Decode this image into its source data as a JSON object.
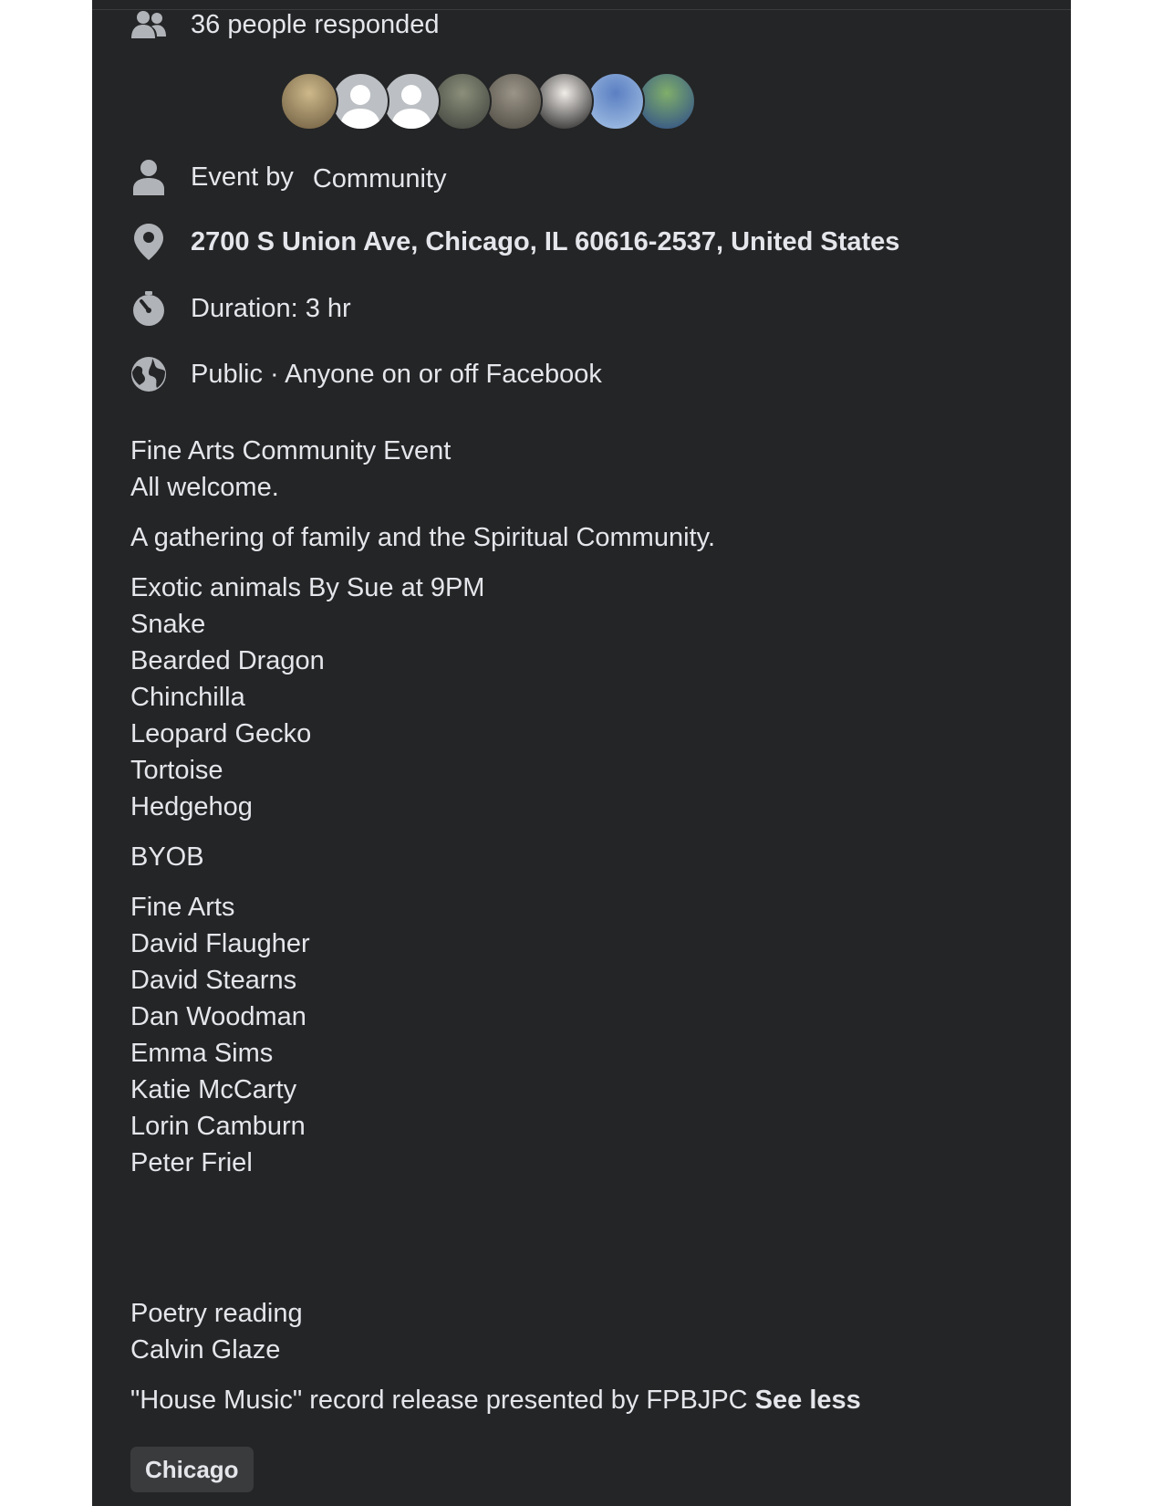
{
  "responded": {
    "text": "36 people responded",
    "icon": "people-icon"
  },
  "avatars": [
    {
      "name": "avatar-1",
      "colors": [
        "#cdb88a",
        "#6b5a3e"
      ]
    },
    {
      "name": "avatar-2-default",
      "colors": [
        "#bcc0c4",
        "#ffffff"
      ]
    },
    {
      "name": "avatar-3-default",
      "colors": [
        "#bcc0c4",
        "#ffffff"
      ]
    },
    {
      "name": "avatar-4",
      "colors": [
        "#8b8f7a",
        "#3b3f3a"
      ]
    },
    {
      "name": "avatar-5",
      "colors": [
        "#9a9488",
        "#4a463e"
      ]
    },
    {
      "name": "avatar-6",
      "colors": [
        "#f0ece8",
        "#1a1a1a"
      ]
    },
    {
      "name": "avatar-7",
      "colors": [
        "#5b7fc2",
        "#a7c4e6"
      ]
    },
    {
      "name": "avatar-8",
      "colors": [
        "#7fae6a",
        "#2c4a8a"
      ]
    }
  ],
  "event_by": {
    "prefix": "Event by",
    "name": "Community",
    "icon": "person-icon"
  },
  "location": {
    "text": "2700 S Union Ave, Chicago, IL 60616-2537, United States",
    "icon": "location-pin-icon"
  },
  "duration": {
    "text": "Duration: 3 hr",
    "icon": "stopwatch-icon"
  },
  "privacy": {
    "text": "Public · Anyone on or off Facebook",
    "icon": "globe-icon"
  },
  "description": {
    "title": "Fine Arts Community Event",
    "welcome": "All welcome.",
    "gathering": "A gathering of family and the Spiritual Community.",
    "animals_heading": "Exotic animals By Sue at 9PM",
    "animals": [
      "Snake",
      "Bearded Dragon",
      "Chinchilla",
      "Leopard Gecko",
      "Tortoise",
      "Hedgehog"
    ],
    "byob": "BYOB",
    "arts_heading": "Fine Arts",
    "artists": [
      "David Flaugher",
      "David Stearns",
      "Dan Woodman",
      "Emma Sims",
      "Katie McCarty",
      "Lorin Camburn",
      "Peter Friel"
    ],
    "poetry_heading": "Poetry reading",
    "poet": "Calvin Glaze",
    "music": "\"House Music\" record release presented by FPBJPC",
    "see_less": "See less"
  },
  "tag": {
    "label": "Chicago"
  },
  "colors": {
    "panel_bg": "#242526",
    "text": "#e4e6eb",
    "icon": "#b0b3b8",
    "chip_bg": "#3a3b3c"
  }
}
